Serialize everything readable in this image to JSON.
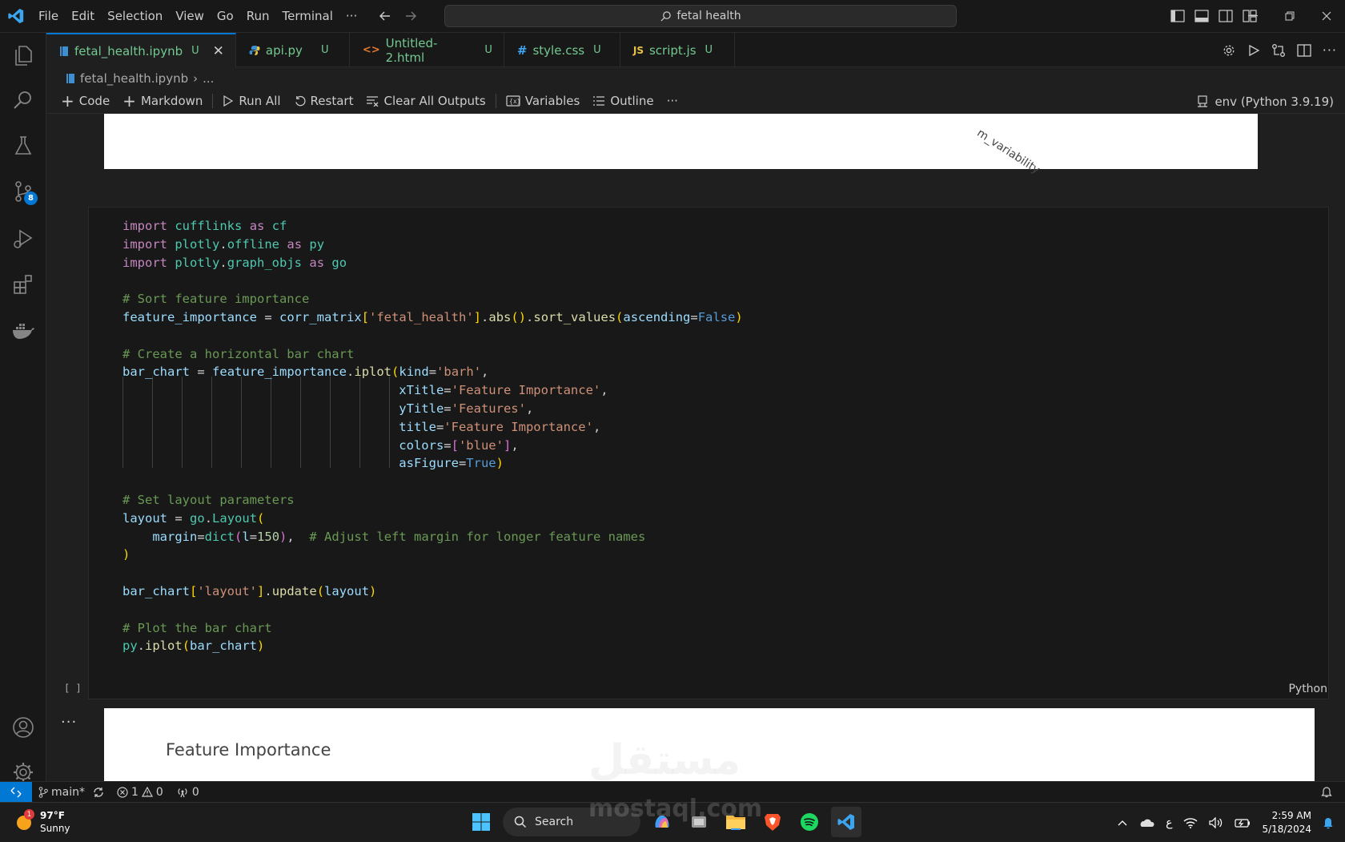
{
  "titlebar": {
    "menu": [
      "File",
      "Edit",
      "Selection",
      "View",
      "Go",
      "Run",
      "Terminal",
      "···"
    ],
    "search": "fetal health"
  },
  "activity": {
    "source_control_badge": "8"
  },
  "tabs": [
    {
      "name": "fetal_health.ipynb",
      "status": "U",
      "icon": "notebook-icon",
      "active": true
    },
    {
      "name": "api.py",
      "status": "U",
      "icon": "python-icon"
    },
    {
      "name": "Untitled-2.html",
      "status": "U",
      "icon": "html-icon"
    },
    {
      "name": "style.css",
      "status": "U",
      "icon": "css-icon"
    },
    {
      "name": "script.js",
      "status": "U",
      "icon": "js-icon"
    }
  ],
  "breadcrumb": {
    "file": "fetal_health.ipynb",
    "more": "..."
  },
  "toolbar": {
    "code": "Code",
    "markdown": "Markdown",
    "run_all": "Run All",
    "restart": "Restart",
    "clear": "Clear All Outputs",
    "variables": "Variables",
    "outline": "Outline",
    "more": "···",
    "kernel": "env (Python 3.9.19)"
  },
  "output_top": {
    "rotated_label": "m_variability"
  },
  "cell": {
    "exec": "[ ]",
    "lang": "Python"
  },
  "output_bottom": {
    "more": "...",
    "chart_title": "Feature Importance"
  },
  "statusbar": {
    "branch": "main*",
    "errors": "1",
    "warnings": "0",
    "ports": "0"
  },
  "taskbar": {
    "weather_temp": "97°F",
    "weather_desc": "Sunny",
    "weather_badge": "1",
    "search": "Search",
    "time": "2:59 AM",
    "date": "5/18/2024",
    "lang": "ع"
  },
  "watermark": {
    "main": "مستقل",
    "sub": "mostaql.com"
  }
}
